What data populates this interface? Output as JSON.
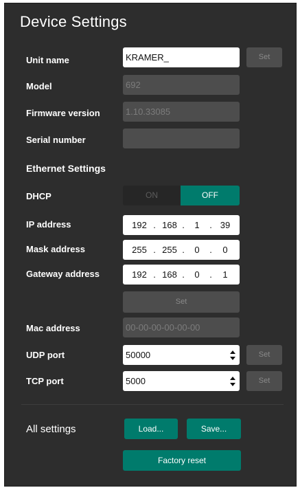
{
  "title": "Device Settings",
  "device": {
    "unit_name_label": "Unit name",
    "unit_name_value": "KRAMER_",
    "model_label": "Model",
    "model_value": "692",
    "firmware_label": "Firmware version",
    "firmware_value": "1.10.33085",
    "serial_label": "Serial number",
    "serial_value": "",
    "set_label": "Set"
  },
  "ethernet": {
    "title": "Ethernet Settings",
    "dhcp_label": "DHCP",
    "dhcp_on": "ON",
    "dhcp_off": "OFF",
    "ip_label": "IP address",
    "ip": [
      "192",
      "168",
      "1",
      "39"
    ],
    "mask_label": "Mask address",
    "mask": [
      "255",
      "255",
      "0",
      "0"
    ],
    "gateway_label": "Gateway address",
    "gateway": [
      "192",
      "168",
      "0",
      "1"
    ],
    "set_label": "Set",
    "mac_label": "Mac address",
    "mac_value": "00-00-00-00-00-00",
    "udp_label": "UDP port",
    "udp_value": "50000",
    "tcp_label": "TCP port",
    "tcp_value": "5000",
    "dot": "."
  },
  "all_settings": {
    "label": "All settings",
    "load_label": "Load...",
    "save_label": "Save...",
    "factory_reset_label": "Factory reset"
  },
  "colors": {
    "panel_bg": "#2d2d2d",
    "field_disabled": "#4d4d4d",
    "accent": "#007b6c"
  }
}
